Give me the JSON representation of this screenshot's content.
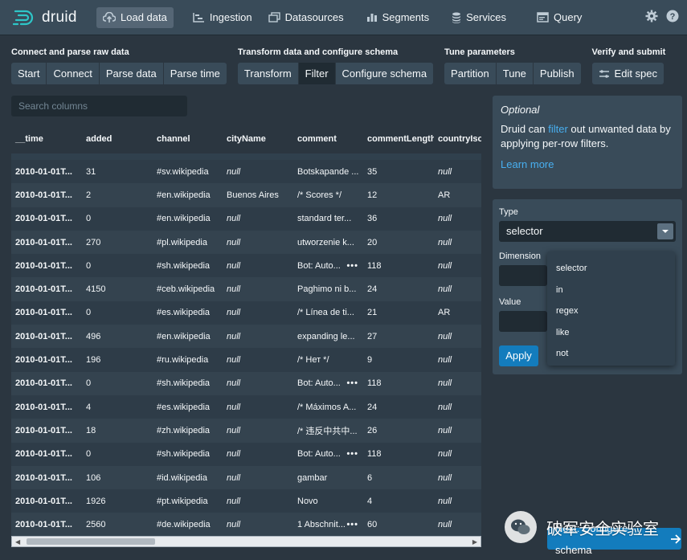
{
  "navbar": {
    "logo_text": "druid",
    "items": [
      {
        "label": "Load data",
        "icon": "cloud-upload-icon",
        "active": true
      },
      {
        "label": "Ingestion",
        "icon": "gantt-chart-icon"
      },
      {
        "label": "Datasources",
        "icon": "multi-select-icon"
      },
      {
        "label": "Segments",
        "icon": "stacked-chart-icon"
      },
      {
        "label": "Services",
        "icon": "database-icon"
      },
      {
        "label": "Query",
        "icon": "application-icon"
      }
    ],
    "right_icons": [
      "gear-icon",
      "help-icon"
    ]
  },
  "steps": [
    {
      "title": "Connect and parse raw data",
      "buttons": [
        "Start",
        "Connect",
        "Parse data",
        "Parse time"
      ]
    },
    {
      "title": "Transform data and configure schema",
      "buttons": [
        "Transform",
        "Filter",
        "Configure schema"
      ],
      "active": "Filter"
    },
    {
      "title": "Tune parameters",
      "buttons": [
        "Partition",
        "Tune",
        "Publish"
      ]
    },
    {
      "title": "Verify and submit",
      "buttons": [
        "Edit spec"
      ]
    }
  ],
  "search": {
    "placeholder": "Search columns"
  },
  "table": {
    "columns": [
      "__time",
      "added",
      "channel",
      "cityName",
      "comment",
      "commentLength",
      "countryIsoCode"
    ],
    "rows": [
      [
        "2010-01-01T...",
        "31",
        "#sv.wikipedia",
        "null",
        "Botskapande ...",
        "35",
        "null"
      ],
      [
        "2010-01-01T...",
        "2",
        "#en.wikipedia",
        "Buenos Aires",
        "/* Scores */",
        "12",
        "AR"
      ],
      [
        "2010-01-01T...",
        "0",
        "#en.wikipedia",
        "null",
        "standard ter...",
        "36",
        "null"
      ],
      [
        "2010-01-01T...",
        "270",
        "#pl.wikipedia",
        "null",
        "utworzenie k...",
        "20",
        "null"
      ],
      [
        "2010-01-01T...",
        "0",
        "#sh.wikipedia",
        "null",
        "Bot: Auto...",
        "118",
        "null"
      ],
      [
        "2010-01-01T...",
        "4150",
        "#ceb.wikipedia",
        "null",
        "Paghimo ni b...",
        "24",
        "null"
      ],
      [
        "2010-01-01T...",
        "0",
        "#es.wikipedia",
        "null",
        "/* Línea de ti...",
        "21",
        "AR"
      ],
      [
        "2010-01-01T...",
        "496",
        "#en.wikipedia",
        "null",
        "expanding le...",
        "27",
        "null"
      ],
      [
        "2010-01-01T...",
        "196",
        "#ru.wikipedia",
        "null",
        "/* Нет */",
        "9",
        "null"
      ],
      [
        "2010-01-01T...",
        "0",
        "#sh.wikipedia",
        "null",
        "Bot: Auto...",
        "118",
        "null"
      ],
      [
        "2010-01-01T...",
        "4",
        "#es.wikipedia",
        "null",
        "/* Máximos A...",
        "24",
        "null"
      ],
      [
        "2010-01-01T...",
        "18",
        "#zh.wikipedia",
        "null",
        "/* 违反中共中...",
        "26",
        "null"
      ],
      [
        "2010-01-01T...",
        "0",
        "#sh.wikipedia",
        "null",
        "Bot: Auto...",
        "118",
        "null"
      ],
      [
        "2010-01-01T...",
        "106",
        "#id.wikipedia",
        "null",
        "gambar",
        "6",
        "null"
      ],
      [
        "2010-01-01T...",
        "1926",
        "#pt.wikipedia",
        "null",
        "Novo",
        "4",
        "null"
      ],
      [
        "2010-01-01T...",
        "2560",
        "#de.wikipedia",
        "null",
        "1 Abschnit...",
        "60",
        "null"
      ]
    ],
    "dots_rows": [
      4,
      9,
      12,
      15
    ]
  },
  "callout": {
    "title": "Optional",
    "desc_pre": "Druid can ",
    "desc_link": "filter",
    "desc_post": " out unwanted data by applying per-row filters.",
    "learn_more": "Learn more"
  },
  "filter_form": {
    "type_label": "Type",
    "type_value": "selector",
    "dimension_label": "Dimension",
    "value_label": "Value",
    "apply_label": "Apply",
    "type_options": [
      "selector",
      "in",
      "regex",
      "like",
      "not"
    ]
  },
  "next_button": {
    "label": "Next: Configure schema"
  },
  "watermark": {
    "text": "破军安全实验室"
  },
  "colors": {
    "primary": "#137cbd",
    "link": "#48aff0",
    "panel": "#394b59",
    "background": "#2b3640"
  }
}
